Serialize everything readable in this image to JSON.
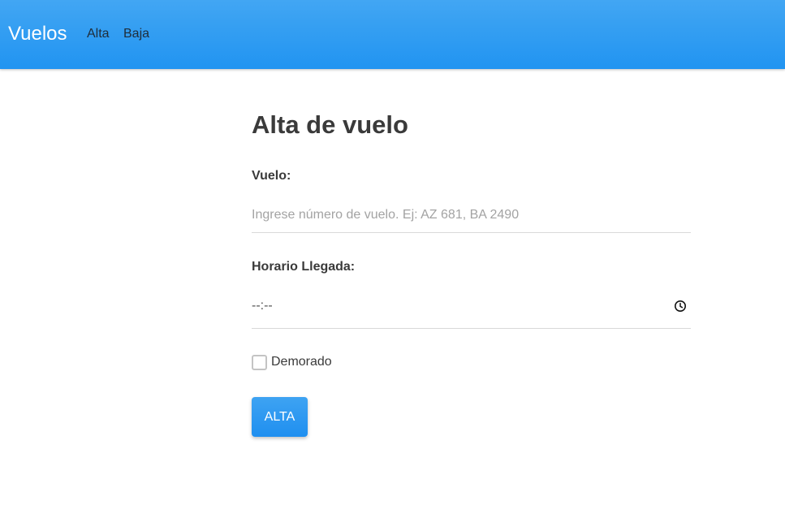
{
  "navbar": {
    "brand": "Vuelos",
    "links": [
      {
        "label": "Alta"
      },
      {
        "label": "Baja"
      }
    ],
    "color": "#2194f1"
  },
  "form": {
    "title": "Alta de vuelo",
    "vuelo": {
      "label": "Vuelo:",
      "value": "",
      "placeholder": "Ingrese número de vuelo. Ej: AZ 681, BA 2490"
    },
    "horario": {
      "label": "Horario Llegada:",
      "value": "--:--",
      "icon": "clock-icon"
    },
    "demorado": {
      "label": "Demorado",
      "checked": false
    },
    "submit_label": "ALTA"
  }
}
